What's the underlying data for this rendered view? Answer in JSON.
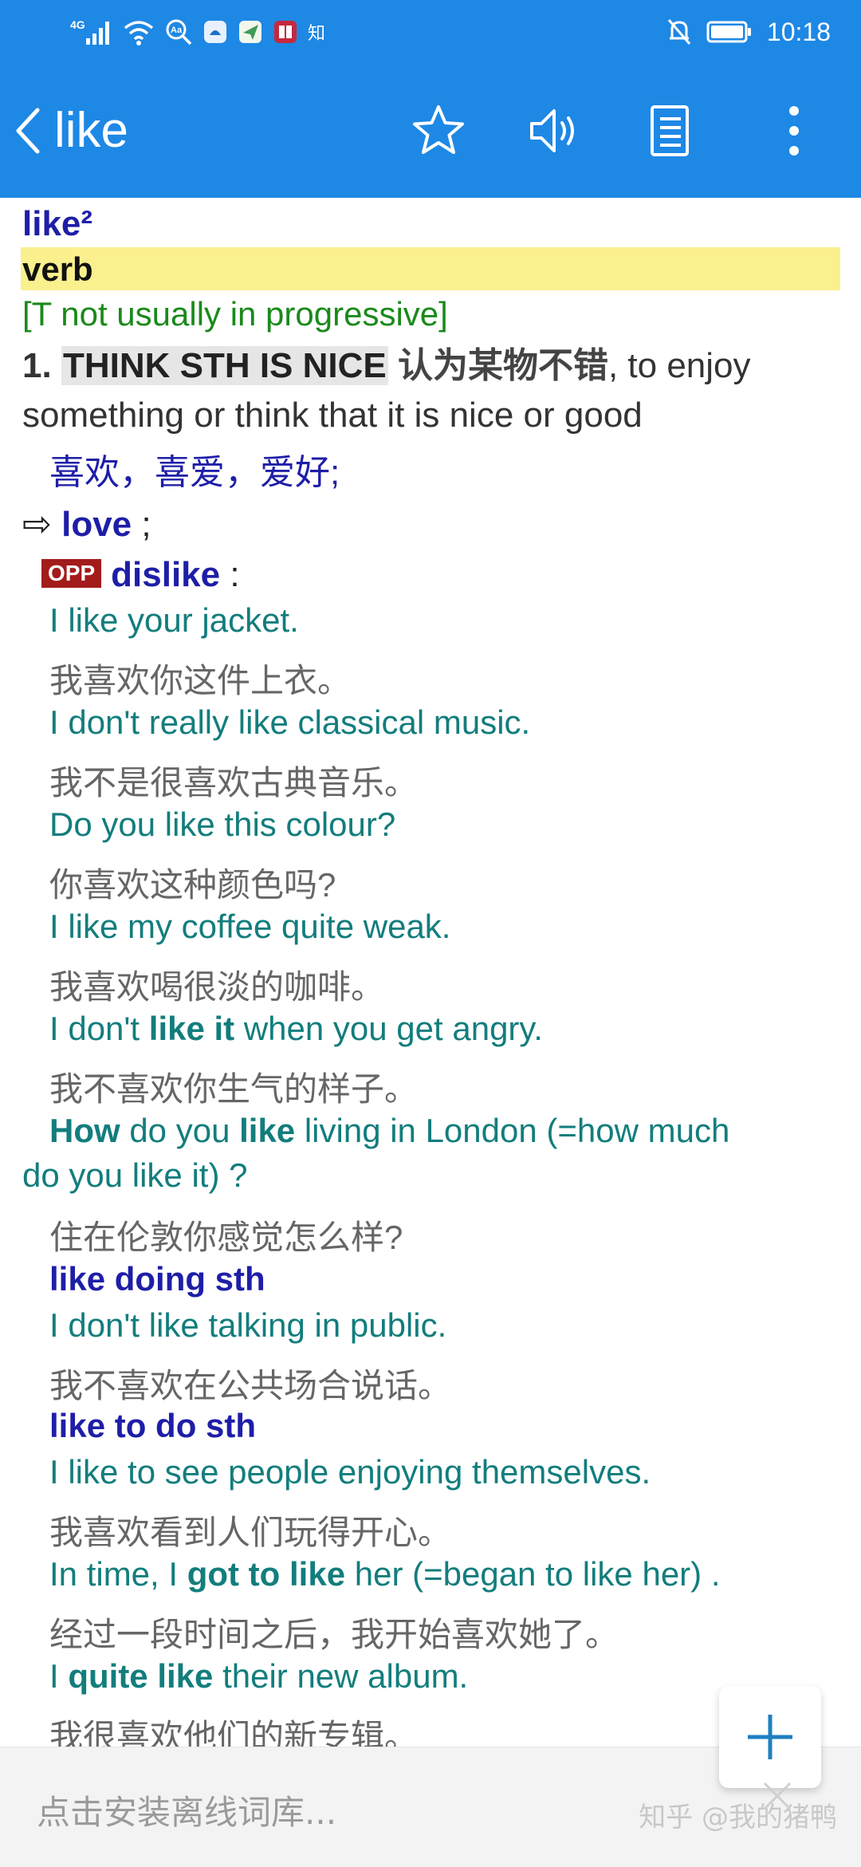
{
  "status_bar": {
    "network": "4G",
    "zhihu_mark": "知",
    "time": "10:18"
  },
  "app_bar": {
    "title": "like",
    "icons": [
      "back-icon",
      "star-icon",
      "speaker-icon",
      "notebook-icon",
      "more-icon"
    ]
  },
  "entry": {
    "headword": "like²",
    "pos": "verb",
    "grammar": "[T not usually in progressive]",
    "sense": {
      "number": "1.",
      "tag": "THINK STH IS NICE",
      "zh_tag": "认为某物不错",
      "definition": ", to enjoy something or think that it is nice or good",
      "definition_zh": "喜欢，喜爱，爱好;"
    },
    "synonym": {
      "arrow": "⇨",
      "word": "love",
      "punct": " ;"
    },
    "opposite": {
      "badge": "OPP",
      "word": "dislike",
      "punct": " :"
    },
    "examples": {
      "ex1_en": "I like your jacket.",
      "ex1_zh": "我喜欢你这件上衣。",
      "ex2_en": "I don't really like classical music.",
      "ex2_zh": "我不是很喜欢古典音乐。",
      "ex3_en": "Do you like this colour?",
      "ex3_zh": "你喜欢这种颜色吗?",
      "ex4_en": "I like my coffee quite weak.",
      "ex4_zh": "我喜欢喝很淡的咖啡。",
      "ex5_a": "I don't ",
      "ex5_b": "like it",
      "ex5_c": " when you get angry.",
      "ex5_zh": "我不喜欢你生气的样子。",
      "ex6_a": "How",
      "ex6_b": " do you ",
      "ex6_c": "like",
      "ex6_d": " living in London (=how much",
      "ex6_e": "do you like it) ?",
      "ex6_zh": "住在伦敦你感觉怎么样?",
      "phrase1": "like doing sth",
      "ex7_en": "I don't like talking in public.",
      "ex7_zh": "我不喜欢在公共场合说话。",
      "phrase2": "like to do sth",
      "ex8_en": "I like to see people enjoying themselves.",
      "ex8_zh": "我喜欢看到人们玩得开心。",
      "ex9_a": "In time, I ",
      "ex9_b": "got to like",
      "ex9_c": " her (=began to like her) .",
      "ex9_zh": "经过一段时间之后，我开始喜欢她了。",
      "ex10_a": "I ",
      "ex10_b": "quite like",
      "ex10_c": " their new album.",
      "ex10_zh": "我很喜欢他们的新专辑。"
    }
  },
  "bottom_bar": {
    "install_hint": "点击安装离线词库...",
    "watermark": "知乎 @我的猪鸭"
  },
  "fab": {
    "icon": "plus-icon"
  },
  "colors": {
    "primary": "#1e88e5",
    "headword": "#1e1ea8",
    "example": "#137d7d",
    "grammar": "#1a8a1a",
    "highlight": "#fbf08e",
    "opp_badge": "#a31b1b"
  }
}
